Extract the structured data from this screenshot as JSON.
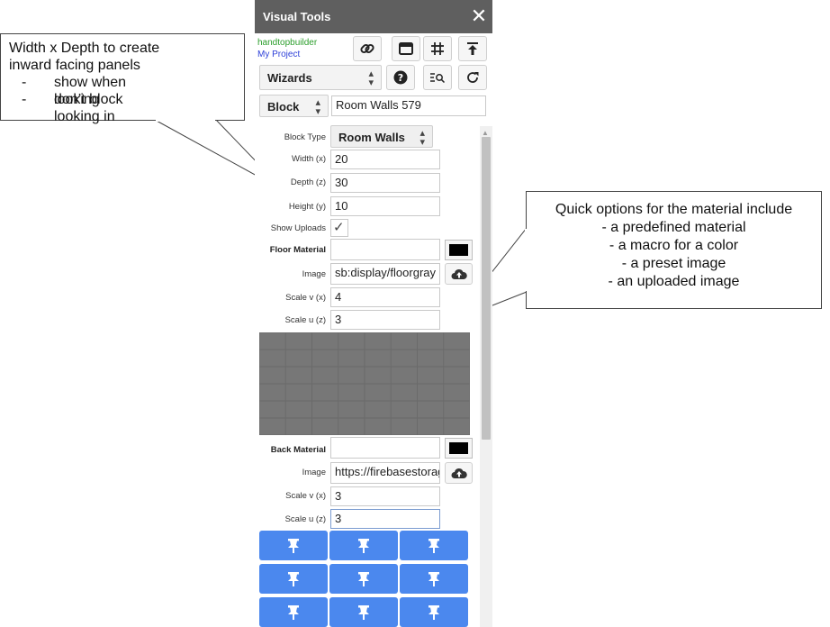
{
  "panel": {
    "title": "Visual Tools",
    "close_glyph": "✕",
    "owner": "handtopbuilder",
    "project": "My Project",
    "toolbar_icons": [
      "link-icon",
      "window-icon",
      "grid-icon",
      "upload-top-icon",
      "help-icon",
      "search-list-icon",
      "refresh-icon"
    ],
    "wizards_select": "Wizards",
    "object_type_select": "Block",
    "object_name": "Room Walls 579",
    "fields": {
      "block_type_label": "Block Type",
      "block_type_value": "Room Walls",
      "width_label": "Width (x)",
      "width_value": "20",
      "depth_label": "Depth (z)",
      "depth_value": "30",
      "height_label": "Height (y)",
      "height_value": "10",
      "show_uploads_label": "Show Uploads",
      "show_uploads_checked": "✓"
    },
    "floor": {
      "material_label": "Floor Material",
      "material_value": "",
      "swatch_color": "#000000",
      "image_label": "Image",
      "image_value": "sb:display/floorgray",
      "scale_v_label": "Scale v (x)",
      "scale_v_value": "4",
      "scale_u_label": "Scale u (z)",
      "scale_u_value": "3"
    },
    "back": {
      "material_label": "Back Material",
      "material_value": "",
      "swatch_color": "#000000",
      "image_label": "Image",
      "image_value": "https://firebasestorag",
      "scale_v_label": "Scale v (x)",
      "scale_v_value": "3",
      "scale_u_label": "Scale u (z)",
      "scale_u_value": "3"
    },
    "pin_button_color": "#4b88ee"
  },
  "callouts": {
    "left": {
      "line1": "Width x Depth to create",
      "line2": "inward facing panels",
      "bullets": [
        "show when looking",
        "don’t block looking in"
      ],
      "dash": "-"
    },
    "right": {
      "lines": [
        "Quick options for the material include",
        "- a predefined material",
        "- a macro for a color",
        "- a preset image",
        "- an uploaded image"
      ]
    }
  }
}
